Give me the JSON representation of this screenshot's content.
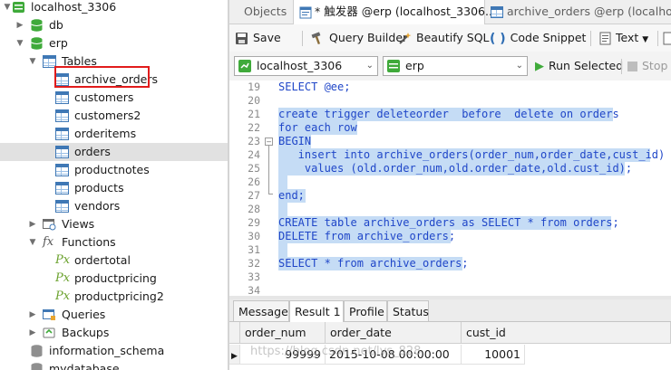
{
  "tree": {
    "connection": "localhost_3306",
    "databases": {
      "db": "db",
      "erp": "erp",
      "information_schema": "information_schema",
      "mydatabase": "mydatabase"
    },
    "groups": {
      "tables": "Tables",
      "views": "Views",
      "functions": "Functions",
      "queries": "Queries",
      "backups": "Backups"
    },
    "tables": [
      "archive_orders",
      "customers",
      "customers2",
      "orderitems",
      "orders",
      "productnotes",
      "products",
      "vendors"
    ],
    "functions": [
      "ordertotal",
      "productpricing",
      "productpricing2"
    ]
  },
  "tabs": {
    "objects": "Objects",
    "trigger": "* 触发器 @erp (localhost_3306...",
    "archive": "archive_orders @erp (localhost..."
  },
  "toolbar": {
    "save": "Save",
    "query_builder": "Query Builder",
    "beautify": "Beautify SQL",
    "snippet": "Code Snippet",
    "text": "Text",
    "run": "Run Selected",
    "stop": "Stop"
  },
  "selectors": {
    "connection": "localhost_3306",
    "database": "erp"
  },
  "editor": {
    "line_numbers": [
      "19",
      "20",
      "21",
      "22",
      "23",
      "24",
      "25",
      "26",
      "27",
      "28",
      "29",
      "30",
      "31",
      "32",
      "33",
      "34"
    ],
    "lines": {
      "l19": "SELECT @ee;",
      "l21": "create trigger deleteorder  before  delete on orders",
      "l22": "for each row",
      "l23": "BEGIN",
      "l24": "   insert into archive_orders(order_num,order_date,cust_id)",
      "l25": "    values (old.order_num,old.order_date,old.cust_id);",
      "l27": "end;",
      "l29": "CREATE table archive_orders as SELECT * from orders;",
      "l30": "DELETE from archive_orders;",
      "l32": "SELECT * from archive_orders;"
    }
  },
  "results": {
    "tabs": [
      "Message",
      "Result 1",
      "Profile",
      "Status"
    ],
    "columns": [
      "order_num",
      "order_date",
      "cust_id"
    ],
    "rows": [
      [
        "99999",
        "2015-10-08 00:00:00",
        "10001"
      ]
    ]
  },
  "watermark": "https://blog.csdn.net/lys_828",
  "colors": {
    "keyword": "#1f46c8",
    "selection": "#c5dcf5",
    "highlight_box": "#e11b1b",
    "db_icon": "#3faa3a",
    "table_icon": "#3f78b5"
  }
}
